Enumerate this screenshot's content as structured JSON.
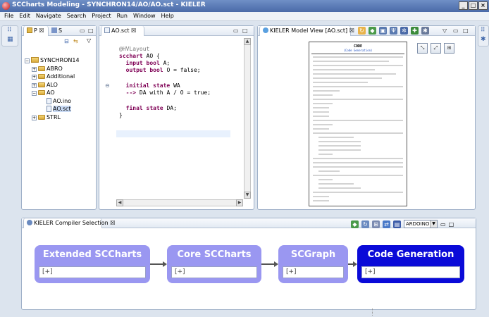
{
  "window": {
    "title": "SCCharts Modeling - SYNCHRON14/AO/AO.sct - KIELER",
    "controls": [
      "_",
      "□",
      "×"
    ]
  },
  "menu": [
    "File",
    "Edit",
    "Navigate",
    "Search",
    "Project",
    "Run",
    "Window",
    "Help"
  ],
  "project_explorer": {
    "tab_label": "P",
    "tab2_label": "S",
    "tree": [
      {
        "label": "SYNCHRON14",
        "level": 0,
        "type": "project",
        "expander": "−"
      },
      {
        "label": "ABRO",
        "level": 1,
        "type": "folder",
        "expander": "+"
      },
      {
        "label": "Additional",
        "level": 1,
        "type": "folder",
        "expander": "+"
      },
      {
        "label": "ALO",
        "level": 1,
        "type": "folder",
        "expander": "+"
      },
      {
        "label": "AO",
        "level": 1,
        "type": "folder",
        "expander": "−"
      },
      {
        "label": "AO.ino",
        "level": 2,
        "type": "file",
        "expander": ""
      },
      {
        "label": "AO.sct",
        "level": 2,
        "type": "file",
        "expander": "",
        "selected": true
      },
      {
        "label": "STRL",
        "level": 1,
        "type": "folder",
        "expander": "+"
      }
    ]
  },
  "editor": {
    "tab_label": "AO.sct",
    "lines": [
      {
        "text": "@HVLayout",
        "annot": true
      },
      {
        "kw": "scchart",
        "rest": " AO {"
      },
      {
        "kw": "  input bool",
        "rest": " A;"
      },
      {
        "kw": "  output bool",
        "rest": " O = false;"
      },
      {
        "text": ""
      },
      {
        "kw": "  initial state",
        "rest": " WA",
        "fold": "⊖"
      },
      {
        "kw": "  --> ",
        "rest": "DA with A / O = true;"
      },
      {
        "text": ""
      },
      {
        "kw": "  final state",
        "rest": " DA;"
      },
      {
        "text": "}"
      }
    ]
  },
  "model_view": {
    "tab_label": "KIELER Model View [AO.sct]",
    "doc_title": "CODE",
    "doc_subtitle": "(Code Generation)"
  },
  "compiler_selection": {
    "tab_label": "KIELER Compiler Selection",
    "target": "ARDOINO",
    "stages": [
      {
        "label": "Extended SCCharts",
        "inner": "[+]",
        "color": "#9a97f1"
      },
      {
        "label": "Core SCCharts",
        "inner": "[+]",
        "color": "#9a97f1"
      },
      {
        "label": "SCGraph",
        "inner": "[+]",
        "color": "#9a97f1"
      },
      {
        "label": "Code Generation",
        "inner": "[+]",
        "color": "#0a0ad8"
      }
    ]
  }
}
